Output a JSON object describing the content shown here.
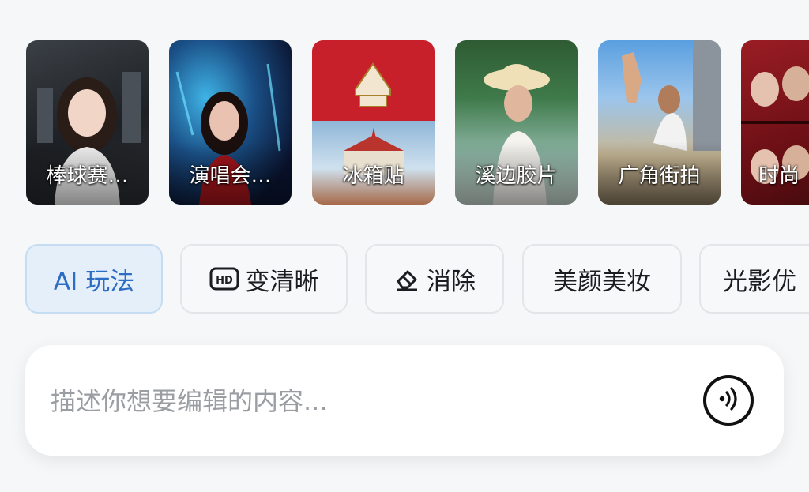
{
  "thumbnails": [
    {
      "label": "棒球赛…",
      "icon": "photo-baseball"
    },
    {
      "label": "演唱会…",
      "icon": "photo-concert"
    },
    {
      "label": "冰箱贴",
      "icon": "photo-fridge-magnet"
    },
    {
      "label": "溪边胶片",
      "icon": "photo-creek-film"
    },
    {
      "label": "广角街拍",
      "icon": "photo-wide-angle-street"
    },
    {
      "label": "时尚",
      "icon": "photo-fashion"
    }
  ],
  "chips": [
    {
      "label": "AI 玩法",
      "active": true
    },
    {
      "label": "变清晰",
      "icon": "hd-icon"
    },
    {
      "label": "消除",
      "icon": "eraser-icon"
    },
    {
      "label": "美颜美妆"
    },
    {
      "label": "光影优"
    }
  ],
  "prompt": {
    "placeholder": "描述你想要编辑的内容...",
    "voice_icon": "voice-icon"
  },
  "colors": {
    "accent": "#2d6cc3",
    "active_chip_bg": "#e4effa",
    "page_bg": "#f6f7f8"
  }
}
